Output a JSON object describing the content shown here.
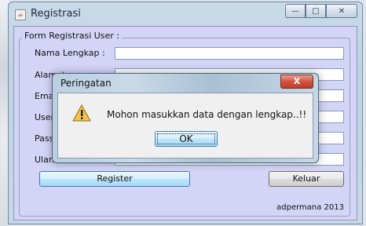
{
  "window": {
    "title": "Registrasi",
    "controls": {
      "minimize": "—",
      "maximize": "□",
      "close": "✕"
    }
  },
  "form": {
    "legend": "Form Registrasi User :",
    "fields": [
      {
        "label": "Nama Lengkap :",
        "value": ""
      },
      {
        "label": "Alamat :",
        "value": ""
      },
      {
        "label": "Email",
        "value": ""
      },
      {
        "label": "User",
        "value": ""
      },
      {
        "label": "Pass",
        "value": ""
      },
      {
        "label": "Ulan",
        "value": ""
      }
    ],
    "register_label": "Register",
    "exit_label": "Keluar",
    "footer": "adpermana 2013"
  },
  "dialog": {
    "title": "Peringatan",
    "close": "X",
    "icon": "warning-icon",
    "message": "Mohon masukkan data dengan lengkap..!!",
    "ok_label": "OK"
  },
  "colors": {
    "form_bg": "#d3d4f6",
    "dialog_close": "#c23a26"
  }
}
